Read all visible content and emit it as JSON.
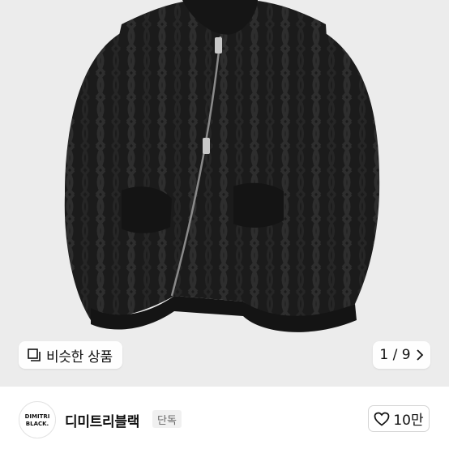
{
  "product": {
    "image_alt_icon": "knit-zip-jacket-photo"
  },
  "gallery": {
    "similar_label": "비슷한 상품",
    "counter": "1 / 9"
  },
  "seller": {
    "logo_text": "DIMITRI BLACK.",
    "logo_line1": "DIMITRI",
    "logo_line2": "BLACK.",
    "name": "디미트리블랙",
    "badge": "단독"
  },
  "like": {
    "count": "10만"
  },
  "colors": {
    "hero_bg": "#ececec",
    "jacket": "#1a1a1a"
  }
}
